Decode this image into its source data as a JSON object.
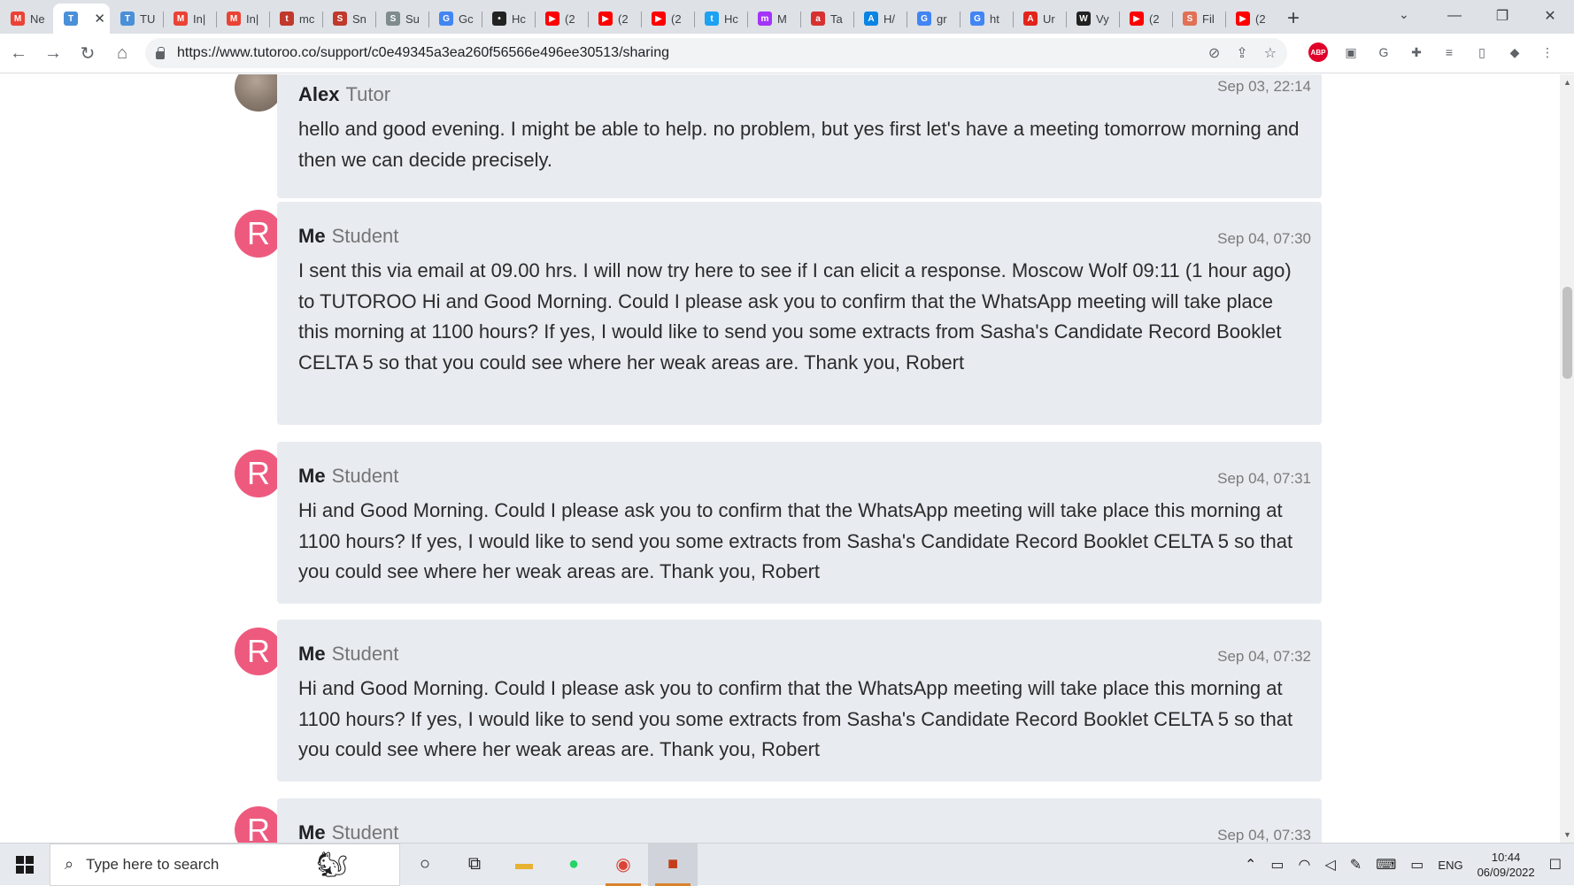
{
  "browser": {
    "tabs": [
      {
        "title": "Ne",
        "icon": "gmail-icon",
        "color": "#ea4335",
        "glyph": "M"
      },
      {
        "title": "",
        "icon": "tutoroo-icon",
        "color": "#4a90d9",
        "glyph": "T",
        "active": true
      },
      {
        "title": "TU",
        "icon": "tutoroo-icon",
        "color": "#4a90d9",
        "glyph": "T"
      },
      {
        "title": "In|",
        "icon": "gmail-icon",
        "color": "#ea4335",
        "glyph": "M"
      },
      {
        "title": "In|",
        "icon": "gmail-icon",
        "color": "#ea4335",
        "glyph": "M"
      },
      {
        "title": "mc",
        "icon": "tumblr-icon",
        "color": "#c0392b",
        "glyph": "t"
      },
      {
        "title": "Sn",
        "icon": "snopes-icon",
        "color": "#c0392b",
        "glyph": "S"
      },
      {
        "title": "Su",
        "icon": "supplier-icon",
        "color": "#7f8c8d",
        "glyph": "S"
      },
      {
        "title": "Gc",
        "icon": "google-translate-icon",
        "color": "#4285f4",
        "glyph": "G"
      },
      {
        "title": "Hc",
        "icon": "dots-icon",
        "color": "#222222",
        "glyph": "•"
      },
      {
        "title": "(2",
        "icon": "youtube-icon",
        "color": "#ff0000",
        "glyph": "▶"
      },
      {
        "title": "(2",
        "icon": "youtube-icon",
        "color": "#ff0000",
        "glyph": "▶"
      },
      {
        "title": "(2",
        "icon": "youtube-icon",
        "color": "#ff0000",
        "glyph": "▶"
      },
      {
        "title": "Hc",
        "icon": "twitter-icon",
        "color": "#1da1f2",
        "glyph": "t"
      },
      {
        "title": "M",
        "icon": "messenger-icon",
        "color": "#a334fa",
        "glyph": "m"
      },
      {
        "title": "Ta",
        "icon": "tab-icon",
        "color": "#d63031",
        "glyph": "a"
      },
      {
        "title": "H/",
        "icon": "rocket-icon",
        "color": "#0984e3",
        "glyph": "A"
      },
      {
        "title": "gr",
        "icon": "google-icon",
        "color": "#4285f4",
        "glyph": "G"
      },
      {
        "title": "ht",
        "icon": "google-icon",
        "color": "#4285f4",
        "glyph": "G"
      },
      {
        "title": "Ur",
        "icon": "acrobat-icon",
        "color": "#e1251b",
        "glyph": "A"
      },
      {
        "title": "Vy",
        "icon": "wikipedia-icon",
        "color": "#222222",
        "glyph": "W"
      },
      {
        "title": "(2",
        "icon": "youtube-icon",
        "color": "#ff0000",
        "glyph": "▶"
      },
      {
        "title": "Fil",
        "icon": "shield-icon",
        "color": "#e17055",
        "glyph": "S"
      },
      {
        "title": "(2",
        "icon": "youtube-icon",
        "color": "#ff0000",
        "glyph": "▶"
      }
    ],
    "url": "https://www.tutoroo.co/support/c0e49345a3ea260f56566e496ee30513/sharing"
  },
  "messages": [
    {
      "sender": "Alex",
      "role": "Tutor",
      "time": "Sep 03, 22:14",
      "avatar": "photo",
      "text": "hello and good evening. I might be able to help. no problem, but yes first let's have a meeting tomorrow morning and then we can decide precisely."
    },
    {
      "sender": "Me",
      "role": "Student",
      "time": "Sep 04, 07:30",
      "avatar_letter": "R",
      "text": "I sent this via email at 09.00 hrs. I will now try here to see if I can elicit a response. Moscow Wolf 09:11 (1 hour ago) to TUTOROO Hi and Good Morning. Could I please ask you to confirm that the WhatsApp meeting will take place this morning at 1100 hours? If yes, I would like to send you some extracts from Sasha's Candidate Record Booklet CELTA 5 so that you could see where her weak areas are. Thank you, Robert"
    },
    {
      "sender": "Me",
      "role": "Student",
      "time": "Sep 04, 07:31",
      "avatar_letter": "R",
      "text": "Hi and Good Morning. Could I please ask you to confirm that the WhatsApp meeting will take place this morning at 1100 hours? If yes, I would like to send you some extracts from Sasha's Candidate Record Booklet CELTA 5 so that you could see where her weak areas are. Thank you, Robert"
    },
    {
      "sender": "Me",
      "role": "Student",
      "time": "Sep 04, 07:32",
      "avatar_letter": "R",
      "text": "Hi and Good Morning. Could I please ask you to confirm that the WhatsApp meeting will take place this morning at 1100 hours? If yes, I would like to send you some extracts from Sasha's Candidate Record Booklet CELTA 5 so that you could see where her weak areas are. Thank you, Robert"
    },
    {
      "sender": "Me",
      "role": "Student",
      "time": "Sep 04, 07:33",
      "avatar_letter": "R",
      "text": ""
    }
  ],
  "taskbar": {
    "search_placeholder": "Type here to search",
    "language": "ENG",
    "time": "10:44",
    "date": "06/09/2022"
  },
  "colors": {
    "avatar": "#ee5a7e",
    "bubble": "#e8ebf0"
  }
}
